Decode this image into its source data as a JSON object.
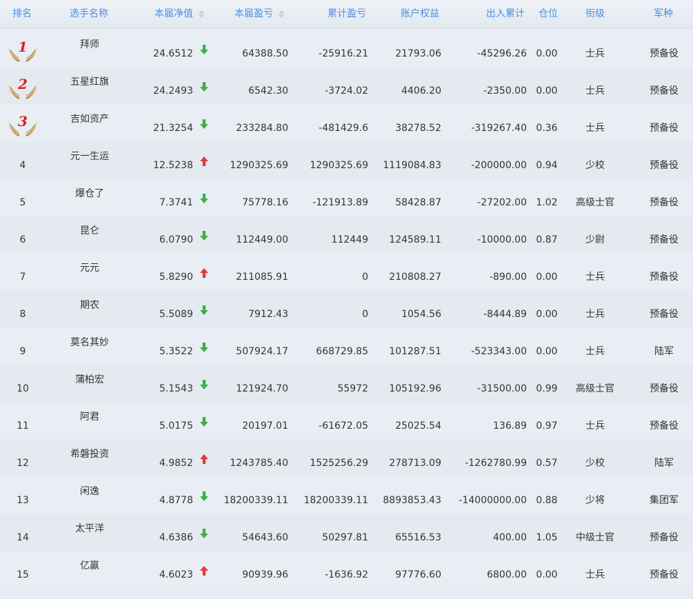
{
  "header": {
    "rank": "排名",
    "name": "选手名称",
    "nav": "本届净值",
    "period_pl": "本届盈亏",
    "cumulative_pl": "累计盈亏",
    "equity": "账户权益",
    "inout": "出入累计",
    "position": "仓位",
    "rank_title": "衔级",
    "arm": "军种"
  },
  "colors": {
    "header_text": "#4a90e2",
    "up": "#e53935",
    "down": "#3cb043",
    "medal_num": "#e02020"
  },
  "rows": [
    {
      "rank": "1",
      "medal": true,
      "name": "拜师",
      "nav": "24.6512",
      "dir": "down",
      "pl": "64388.50",
      "cum": "-25916.21",
      "equity": "21793.06",
      "inout": "-45296.26",
      "pos": "0.00",
      "title": "士兵",
      "arm": "预备役"
    },
    {
      "rank": "2",
      "medal": true,
      "name": "五星红旗",
      "nav": "24.2493",
      "dir": "down",
      "pl": "6542.30",
      "cum": "-3724.02",
      "equity": "4406.20",
      "inout": "-2350.00",
      "pos": "0.00",
      "title": "士兵",
      "arm": "预备役"
    },
    {
      "rank": "3",
      "medal": true,
      "name": "吉如资产",
      "nav": "21.3254",
      "dir": "down",
      "pl": "233284.80",
      "cum": "-481429.6",
      "equity": "38278.52",
      "inout": "-319267.40",
      "pos": "0.36",
      "title": "士兵",
      "arm": "预备役"
    },
    {
      "rank": "4",
      "medal": false,
      "name": "元一生运",
      "nav": "12.5238",
      "dir": "up",
      "pl": "1290325.69",
      "cum": "1290325.69",
      "equity": "1119084.83",
      "inout": "-200000.00",
      "pos": "0.94",
      "title": "少校",
      "arm": "预备役"
    },
    {
      "rank": "5",
      "medal": false,
      "name": "爆仓了",
      "nav": "7.3741",
      "dir": "down",
      "pl": "75778.16",
      "cum": "-121913.89",
      "equity": "58428.87",
      "inout": "-27202.00",
      "pos": "1.02",
      "title": "高级士官",
      "arm": "预备役"
    },
    {
      "rank": "6",
      "medal": false,
      "name": "昆仑",
      "nav": "6.0790",
      "dir": "down",
      "pl": "112449.00",
      "cum": "112449",
      "equity": "124589.11",
      "inout": "-10000.00",
      "pos": "0.87",
      "title": "少尉",
      "arm": "预备役"
    },
    {
      "rank": "7",
      "medal": false,
      "name": "元元",
      "nav": "5.8290",
      "dir": "up",
      "pl": "211085.91",
      "cum": "0",
      "equity": "210808.27",
      "inout": "-890.00",
      "pos": "0.00",
      "title": "士兵",
      "arm": "预备役"
    },
    {
      "rank": "8",
      "medal": false,
      "name": "期农",
      "nav": "5.5089",
      "dir": "down",
      "pl": "7912.43",
      "cum": "0",
      "equity": "1054.56",
      "inout": "-8444.89",
      "pos": "0.00",
      "title": "士兵",
      "arm": "预备役"
    },
    {
      "rank": "9",
      "medal": false,
      "name": "莫名其妙",
      "nav": "5.3522",
      "dir": "down",
      "pl": "507924.17",
      "cum": "668729.85",
      "equity": "101287.51",
      "inout": "-523343.00",
      "pos": "0.00",
      "title": "士兵",
      "arm": "陆军"
    },
    {
      "rank": "10",
      "medal": false,
      "name": "蒲柏宏",
      "nav": "5.1543",
      "dir": "down",
      "pl": "121924.70",
      "cum": "55972",
      "equity": "105192.96",
      "inout": "-31500.00",
      "pos": "0.99",
      "title": "高级士官",
      "arm": "预备役"
    },
    {
      "rank": "11",
      "medal": false,
      "name": "阿君",
      "nav": "5.0175",
      "dir": "down",
      "pl": "20197.01",
      "cum": "-61672.05",
      "equity": "25025.54",
      "inout": "136.89",
      "pos": "0.97",
      "title": "士兵",
      "arm": "预备役"
    },
    {
      "rank": "12",
      "medal": false,
      "name": "希磐投资",
      "nav": "4.9852",
      "dir": "up",
      "pl": "1243785.40",
      "cum": "1525256.29",
      "equity": "278713.09",
      "inout": "-1262780.99",
      "pos": "0.57",
      "title": "少校",
      "arm": "陆军"
    },
    {
      "rank": "13",
      "medal": false,
      "name": "闲逸",
      "nav": "4.8778",
      "dir": "down",
      "pl": "18200339.11",
      "cum": "18200339.11",
      "equity": "8893853.43",
      "inout": "-14000000.00",
      "pos": "0.88",
      "title": "少将",
      "arm": "集团军"
    },
    {
      "rank": "14",
      "medal": false,
      "name": "太平洋",
      "nav": "4.6386",
      "dir": "down",
      "pl": "54643.60",
      "cum": "50297.81",
      "equity": "65516.53",
      "inout": "400.00",
      "pos": "1.05",
      "title": "中级士官",
      "arm": "预备役"
    },
    {
      "rank": "15",
      "medal": false,
      "name": "亿赢",
      "nav": "4.6023",
      "dir": "up",
      "pl": "90939.96",
      "cum": "-1636.92",
      "equity": "97776.60",
      "inout": "6800.00",
      "pos": "0.00",
      "title": "士兵",
      "arm": "预备役"
    }
  ]
}
